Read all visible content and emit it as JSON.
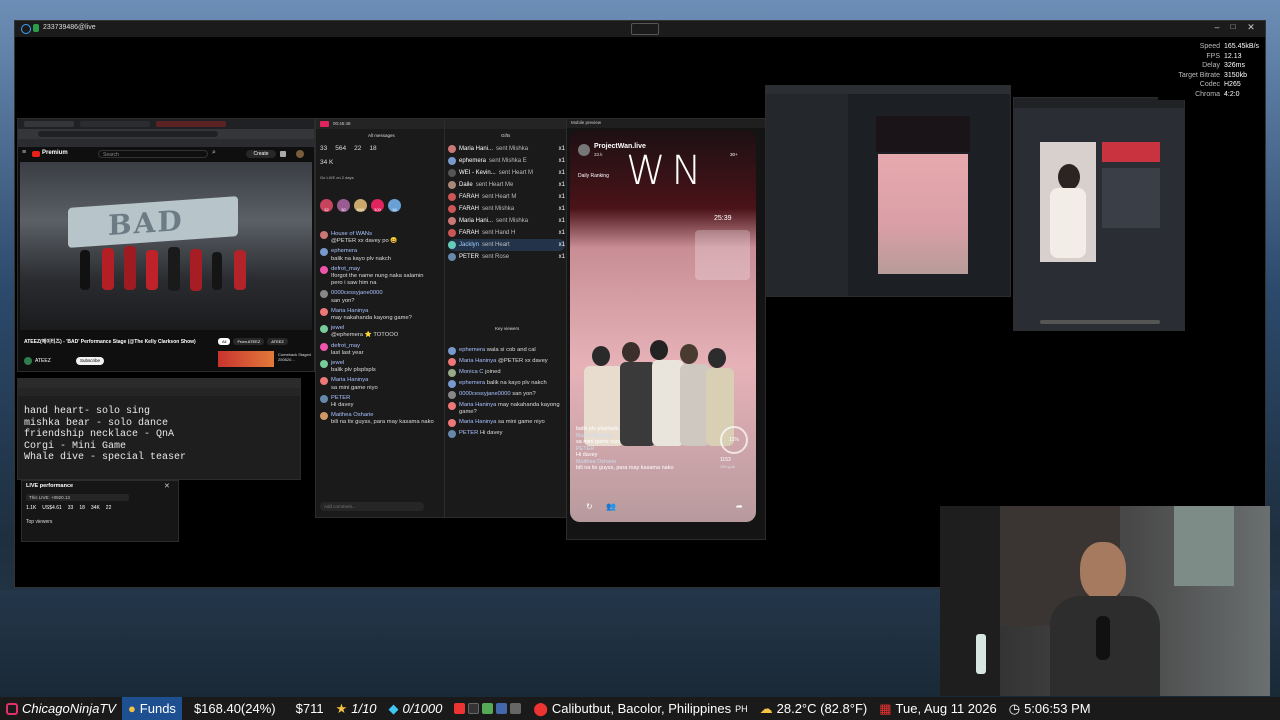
{
  "window": {
    "title": "233739486@live"
  },
  "stream_stats": {
    "labels": [
      "Speed",
      "FPS",
      "Delay",
      "Target Bitrate",
      "Codec",
      "Chroma"
    ],
    "values": [
      "165.45kB/s",
      "12.13",
      "326ms",
      "3150kb",
      "H265",
      "4:2:0"
    ]
  },
  "youtube": {
    "brand": "Premium",
    "search_placeholder": "Search",
    "create_label": "Create",
    "banner_text": "BAD",
    "video_title": "ATEEZ(에이티즈) - 'BAD' Performance Stage (@The Kelly Clarkson Show)",
    "channel": "ATEEZ",
    "subscribe": "Subscribe",
    "chips": [
      "All",
      "From ATEEZ",
      "ATEEZ"
    ],
    "up_next": "Comeback Staged 250620..."
  },
  "notes": {
    "lines": [
      "hand heart- solo sing",
      "mishka bear - solo dance",
      "friendship necklace - QnA",
      "Corgi - Mini Game",
      "Whale dive - special teaser"
    ]
  },
  "live_performance": {
    "title": "LIVE performance",
    "subtitle": "This LIVE: +0920.13",
    "stats": [
      "1.1K",
      "US$4.61",
      "33",
      "18",
      "34K",
      "22"
    ],
    "top_viewers": "Top viewers"
  },
  "tiktok_chat": {
    "header": "All messages",
    "live_time": "00:45:48",
    "stats": [
      "33",
      "564",
      "22",
      "18"
    ],
    "likes": "34 K",
    "badge_line": "Go LIVE on 2 days",
    "gift_counts": [
      "32",
      "30",
      "590",
      "300",
      "16"
    ],
    "messages": [
      {
        "user": "House of WANs",
        "text": "@PETER xx davey po 😄"
      },
      {
        "user": "ephemera",
        "text": "balik na kayo plv nakch"
      },
      {
        "user": "defrot_may",
        "text": "Iforgot the name nung naka salamin pero i saw him na"
      },
      {
        "user": "0000cessyjane0000",
        "text": "san yon?"
      },
      {
        "user": "Maria Haninya",
        "text": "may nakahanda kayong game?"
      },
      {
        "user": "jewel",
        "text": "@ephemera ⭐ TOTOOO"
      },
      {
        "user": "defrot_may",
        "text": "last last year"
      },
      {
        "user": "jewel",
        "text": "balik plv plsplspls"
      },
      {
        "user": "Maria Haninya",
        "text": "sa mini game niyo"
      },
      {
        "user": "PETER",
        "text": "Hi davey"
      },
      {
        "user": "Maithea Osharie",
        "text": "bili na tix guyss, para may kasama nako"
      }
    ],
    "input_placeholder": "Add comment..."
  },
  "gifts": {
    "header": "Gifts",
    "lines": [
      {
        "user": "Maria Hani...",
        "action": "sent Mishka",
        "count": "x1"
      },
      {
        "user": "ephemera",
        "action": "sent Mishka E",
        "count": "x1"
      },
      {
        "user": "WEI - Kevin...",
        "action": "sent Heart M",
        "count": "x1"
      },
      {
        "user": "Daile",
        "action": "sent Heart Me",
        "count": "x1"
      },
      {
        "user": "FARAH",
        "action": "sent Heart M",
        "count": "x1"
      },
      {
        "user": "FARAH",
        "action": "sent Mishka",
        "count": "x1"
      },
      {
        "user": "Maria Hani...",
        "action": "sent Mishka",
        "count": "x1"
      },
      {
        "user": "FARAH",
        "action": "sent Hand H",
        "count": "x1"
      },
      {
        "user": "Jacklyn",
        "action": "sent Heart",
        "count": "x1"
      },
      {
        "user": "PETER",
        "action": "sent Rose",
        "count": "x1"
      }
    ],
    "key_viewers": "Key viewers",
    "comments": [
      {
        "user": "ephemera",
        "text": "wala si cob and cal"
      },
      {
        "user": "Maria Haninya",
        "text": "@PETER xx davey"
      },
      {
        "user": "Monica C",
        "text": "joined"
      },
      {
        "user": "ephemera",
        "text": "balik na kayo plv nakch"
      },
      {
        "user": "0000cessyjane0000",
        "text": "san yon?"
      },
      {
        "user": "Maria Haninya",
        "text": "may nakahanda kayong game?"
      },
      {
        "user": "Maria Haninya",
        "text": "sa mini game niyo"
      },
      {
        "user": "PETER",
        "text": "Hi davey"
      }
    ]
  },
  "mobile_preview": {
    "title": "Mobile preview",
    "account": "ProjectWan.live",
    "followers": "33.k",
    "daily_ranking": "Daily Ranking",
    "logo": "WN",
    "timer": "25:39",
    "viewers": "30+",
    "gift_goal_percent": "11%",
    "gift_goal_value": "1153",
    "gift_goal_label": "Gift goal",
    "overlay_chat": [
      {
        "user": "",
        "text": "balik plv plsplspls"
      },
      {
        "user": "Maria Haninya",
        "text": "sa mini game niyo"
      },
      {
        "user": "PETER",
        "text": "Hi davey"
      },
      {
        "user": "Maithea Osharie",
        "text": "bili na tix guyss, para may kasama nako"
      }
    ]
  },
  "obs_panel": {
    "logo": "WN"
  },
  "ticker": {
    "channel": "ChicagoNinjaTV",
    "funds_label": "Funds",
    "funds_value": "$168.40(24%)",
    "amount": "$711",
    "stars": "1/10",
    "gems": "0/1000",
    "location": "Calibutbut, Bacolor, Philippines",
    "country": "PH",
    "weather": "28.2°C (82.8°F)",
    "date": "Tue, Aug 11 2026",
    "time": "5:06:53 PM"
  }
}
